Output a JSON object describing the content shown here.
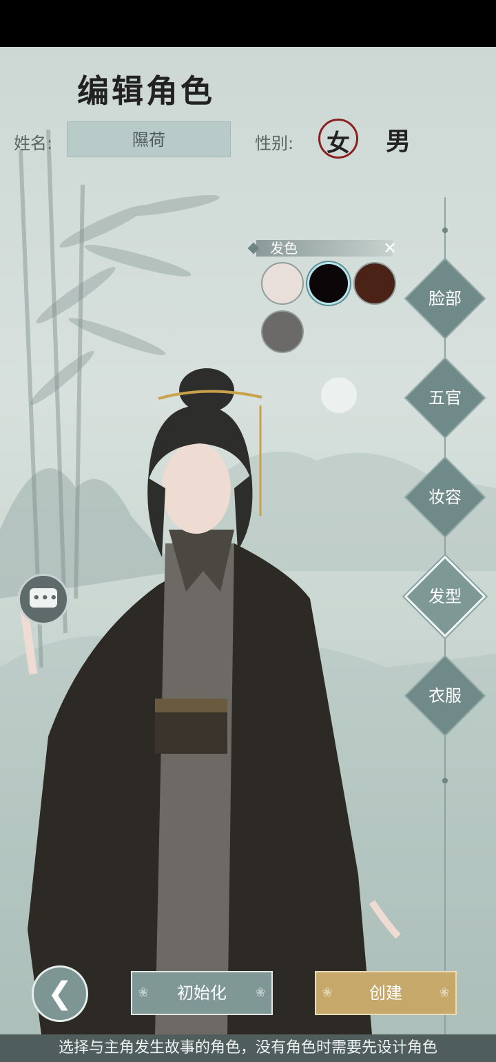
{
  "header": {
    "title": "编辑角色"
  },
  "form": {
    "name_label": "姓名:",
    "name_value": "隰荷",
    "gender_label": "性别:",
    "gender_female": "女",
    "gender_male": "男"
  },
  "hair_color_panel": {
    "title": "发色",
    "close_icon": "close-icon",
    "swatches": [
      "#e9dfda",
      "#0b0708",
      "#4a2216",
      "#6b6a69"
    ],
    "selected_index": 1
  },
  "category_tabs": [
    {
      "label": "脸部",
      "active": false
    },
    {
      "label": "五官",
      "active": false
    },
    {
      "label": "妆容",
      "active": false
    },
    {
      "label": "发型",
      "active": true
    },
    {
      "label": "衣服",
      "active": false
    }
  ],
  "actions": {
    "back_icon": "chevron-left-icon",
    "reset_label": "初始化",
    "create_label": "创建"
  },
  "chat": {
    "icon": "chat-bubble-icon"
  },
  "footer": {
    "hint": "选择与主角发生故事的角色，没有角色时需要先设计角色"
  },
  "colors": {
    "accent": "#6f8a88",
    "gold": "#c5a86a",
    "gender_ring": "#8a1f1f"
  }
}
